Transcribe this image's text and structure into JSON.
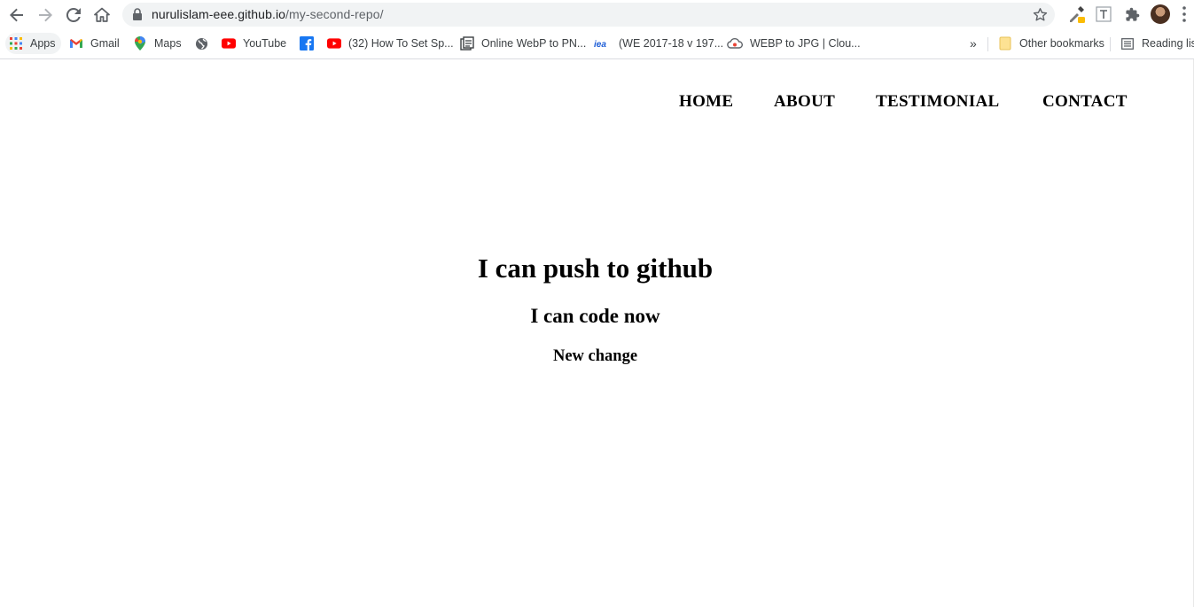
{
  "browser": {
    "url_domain": "nurulislam-eee.github.io",
    "url_path": "/my-second-repo/",
    "bookmarks": [
      {
        "label": "Apps",
        "icon": "apps-grid-icon"
      },
      {
        "label": "Gmail",
        "icon": "gmail-icon"
      },
      {
        "label": "Maps",
        "icon": "maps-pin-icon"
      },
      {
        "label": "",
        "icon": "globe-icon"
      },
      {
        "label": "YouTube",
        "icon": "youtube-icon"
      },
      {
        "label": "",
        "icon": "facebook-icon"
      },
      {
        "label": "(32) How To Set Sp...",
        "icon": "youtube-icon"
      },
      {
        "label": "Online WebP to PN...",
        "icon": "converter-icon"
      },
      {
        "label": "(WE 2017-18 v 197...",
        "icon": "iea-icon"
      },
      {
        "label": "WEBP to JPG | Clou...",
        "icon": "cloud-icon"
      }
    ],
    "other_bookmarks": "Other bookmarks",
    "reading_list": "Reading list"
  },
  "site": {
    "nav": [
      "HOME",
      "ABOUT",
      "TESTIMONIAL",
      "CONTACT"
    ],
    "heading_1": "I can push to github",
    "heading_2": "I can code now",
    "heading_3": "New change"
  }
}
